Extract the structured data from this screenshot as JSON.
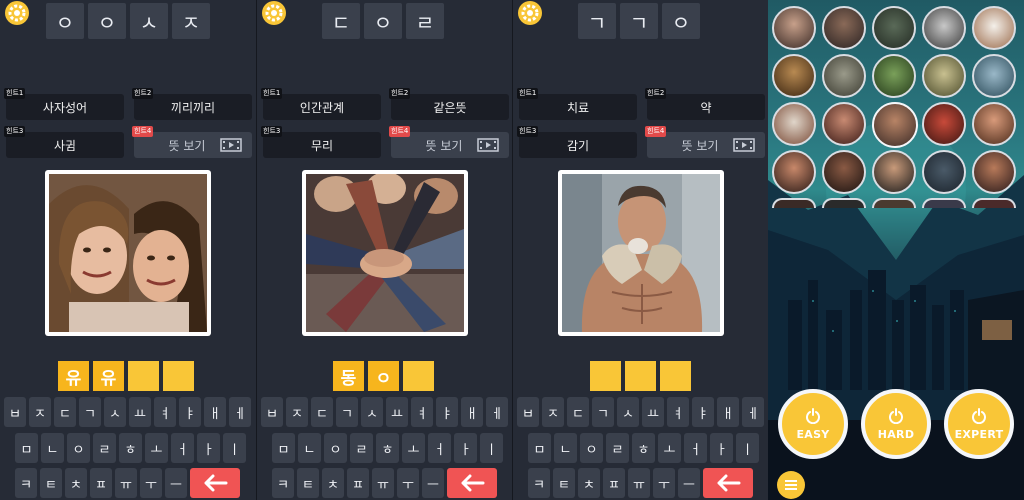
{
  "panels": [
    {
      "letters": [
        "ㅇ",
        "ㅇ",
        "ㅅ",
        "ㅈ"
      ],
      "hints": [
        {
          "tag": "힌트1",
          "text": "사자성어"
        },
        {
          "tag": "힌트2",
          "text": "끼리끼리"
        },
        {
          "tag": "힌트3",
          "text": "사귐"
        },
        {
          "tag": "힌트4",
          "text": "뜻 보기",
          "locked": true
        }
      ],
      "photo_subject": "two-women-portrait",
      "answer": [
        "유",
        "유",
        "",
        ""
      ],
      "keyboard": {
        "row1": [
          "ㅂ",
          "ㅈ",
          "ㄷ",
          "ㄱ",
          "ㅅ",
          "ㅛ",
          "ㅕ",
          "ㅑ",
          "ㅐ",
          "ㅔ"
        ],
        "row2": [
          "ㅁ",
          "ㄴ",
          "ㅇ",
          "ㄹ",
          "ㅎ",
          "ㅗ",
          "ㅓ",
          "ㅏ",
          "ㅣ"
        ],
        "row3": [
          "ㅋ",
          "ㅌ",
          "ㅊ",
          "ㅍ",
          "ㅠ",
          "ㅜ",
          "ㅡ"
        ]
      }
    },
    {
      "letters": [
        "ㄷ",
        "ㅇ",
        "ㄹ"
      ],
      "hints": [
        {
          "tag": "힌트1",
          "text": "인간관계"
        },
        {
          "tag": "힌트2",
          "text": "같은뜻"
        },
        {
          "tag": "힌트3",
          "text": "무리"
        },
        {
          "tag": "힌트4",
          "text": "뜻 보기",
          "locked": true
        }
      ],
      "photo_subject": "stacked-hands",
      "answer": [
        "동",
        "ㅇ",
        ""
      ],
      "keyboard": {
        "row1": [
          "ㅂ",
          "ㅈ",
          "ㄷ",
          "ㄱ",
          "ㅅ",
          "ㅛ",
          "ㅕ",
          "ㅑ",
          "ㅐ",
          "ㅔ"
        ],
        "row2": [
          "ㅁ",
          "ㄴ",
          "ㅇ",
          "ㄹ",
          "ㅎ",
          "ㅗ",
          "ㅓ",
          "ㅏ",
          "ㅣ"
        ],
        "row3": [
          "ㅋ",
          "ㅌ",
          "ㅊ",
          "ㅍ",
          "ㅠ",
          "ㅜ",
          "ㅡ"
        ]
      }
    },
    {
      "letters": [
        "ㄱ",
        "ㄱ",
        "ㅇ"
      ],
      "hints": [
        {
          "tag": "힌트1",
          "text": "치료"
        },
        {
          "tag": "힌트2",
          "text": "약"
        },
        {
          "tag": "힌트3",
          "text": "감기"
        },
        {
          "tag": "힌트4",
          "text": "뜻 보기",
          "locked": true
        }
      ],
      "photo_subject": "muscular-man-with-scarf",
      "answer": [
        "",
        "",
        ""
      ],
      "keyboard": {
        "row1": [
          "ㅂ",
          "ㅈ",
          "ㄷ",
          "ㄱ",
          "ㅅ",
          "ㅛ",
          "ㅕ",
          "ㅑ",
          "ㅐ",
          "ㅔ"
        ],
        "row2": [
          "ㅁ",
          "ㄴ",
          "ㅇ",
          "ㄹ",
          "ㅎ",
          "ㅗ",
          "ㅓ",
          "ㅏ",
          "ㅣ"
        ],
        "row3": [
          "ㅋ",
          "ㅌ",
          "ㅊ",
          "ㅍ",
          "ㅠ",
          "ㅜ",
          "ㅡ"
        ]
      }
    }
  ],
  "levels": {
    "difficulty": [
      {
        "label": "EASY"
      },
      {
        "label": "HARD"
      },
      {
        "label": "EXPERT"
      }
    ]
  },
  "colors": {
    "accent": "#f9c637",
    "backspace": "#f05454",
    "hint_locked_tag": "#e24a4a",
    "panel_bg": "#262b36"
  },
  "icons": [
    "gear-icon",
    "film-icon",
    "backspace-arrow-icon",
    "power-icon",
    "menu-icon"
  ]
}
